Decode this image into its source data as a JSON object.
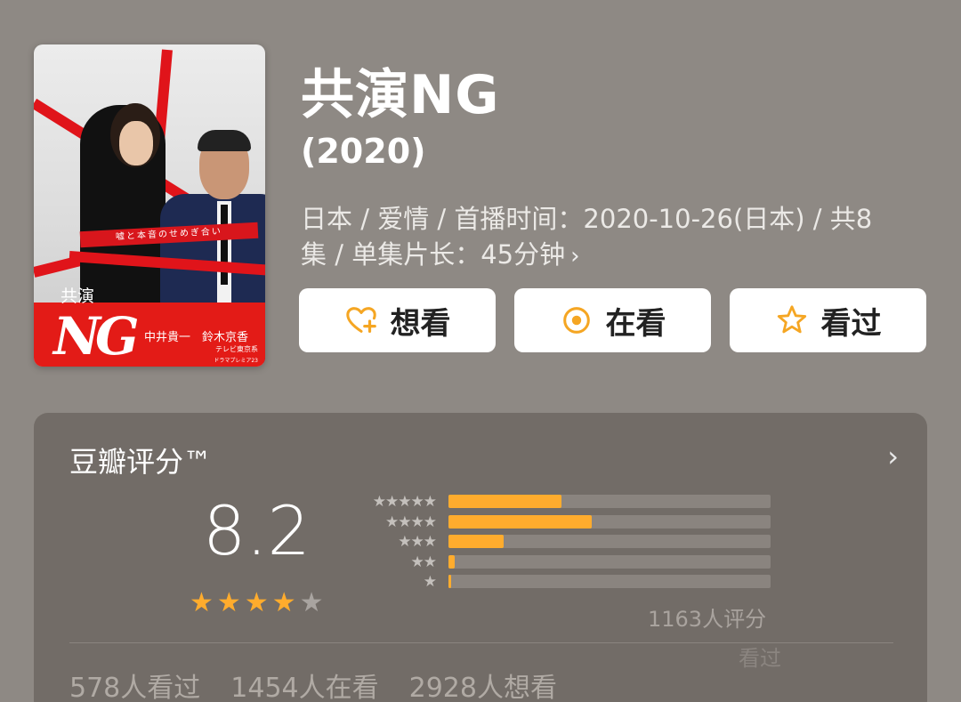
{
  "poster": {
    "ribbon_text": "嘘と本音のせめぎ合い",
    "title_small": "共演",
    "title_logo": "NG",
    "cast": "中井貴一　鈴木京香",
    "network": "テレビ東京系",
    "slot": "ドラマプレミア23"
  },
  "movie": {
    "title": "共演NG",
    "year": "(2020)",
    "meta_line1": "日本 / 爱情 / 首播时间：2020-10-26(日本) / 共8",
    "meta_line2": "集 / 单集片长：45分钟",
    "meta_chevron": "›"
  },
  "actions": {
    "want": "想看",
    "watching": "在看",
    "watched": "看过"
  },
  "rating": {
    "title": "豆瓣评分™",
    "arrow": "›",
    "score": "8.2",
    "stars": 4,
    "stars_max": 5,
    "distribution": [
      {
        "stars": 5,
        "fraction": 0.35
      },
      {
        "stars": 4,
        "fraction": 0.445
      },
      {
        "stars": 3,
        "fraction": 0.17
      },
      {
        "stars": 2,
        "fraction": 0.02
      },
      {
        "stars": 1,
        "fraction": 0.008
      }
    ],
    "count_text": "1163人评分",
    "ghost_text": "看过"
  },
  "counts": {
    "watched": "578人看过",
    "watching": "1454人在看",
    "want": "2928人想看"
  },
  "colors": {
    "background": "#8e8984",
    "card": "#726c67",
    "accent": "#ffac2d",
    "icon_orange": "#f5a623"
  }
}
